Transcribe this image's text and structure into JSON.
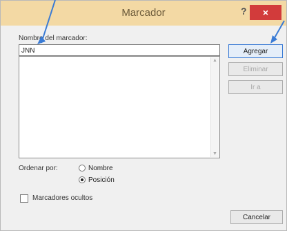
{
  "window": {
    "title": "Marcador",
    "help_glyph": "?",
    "close_glyph": "×"
  },
  "form": {
    "name_label": "Nombre del marcador:",
    "name_value": "JNN",
    "sort_label": "Ordenar por:",
    "sort_options": [
      {
        "label": "Nombre",
        "selected": false
      },
      {
        "label": "Posición",
        "selected": true
      }
    ],
    "hidden_label": "Marcadores ocultos",
    "hidden_checked": false
  },
  "buttons": {
    "add": "Agregar",
    "delete": "Eliminar",
    "goto": "Ir a",
    "cancel": "Cancelar"
  },
  "annotation_arrow_color": "#3a7bd5"
}
